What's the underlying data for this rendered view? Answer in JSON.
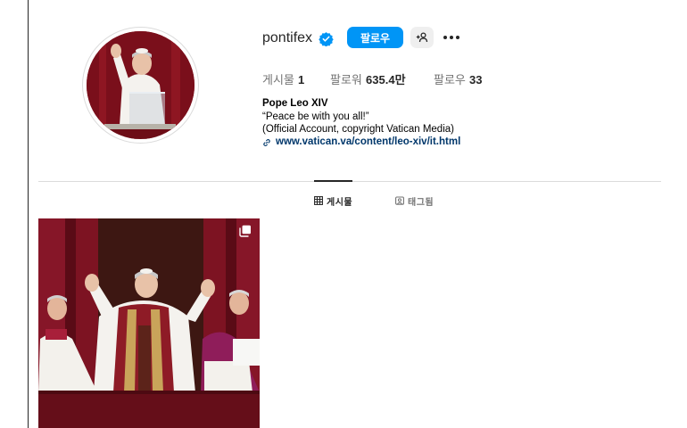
{
  "profile": {
    "username": "pontifex",
    "follow_label": "팔로우",
    "stats": {
      "posts_label": "게시물",
      "posts_value": "1",
      "followers_label": "팔로워",
      "followers_value": "635.4만",
      "following_label": "팔로우",
      "following_value": "33"
    },
    "bio": {
      "name": "Pope Leo XIV",
      "line1": "“Peace be with you all!”",
      "line2": "(Official Account, copyright Vatican Media)",
      "link": "www.vatican.va/content/leo-xiv/it.html"
    }
  },
  "tabs": [
    {
      "label": "게시물",
      "icon": "grid-icon",
      "active": true
    },
    {
      "label": "태그됨",
      "icon": "tagged-icon",
      "active": false
    }
  ],
  "colors": {
    "accent": "#0095f6",
    "link": "#00376b",
    "text": "#262626",
    "muted": "#737373",
    "border": "#dbdbdb"
  },
  "icons": {
    "verified": "verified-badge-icon",
    "suggest": "add-person-icon",
    "more": "more-options-icon",
    "link": "link-icon",
    "multi": "carousel-icon"
  }
}
